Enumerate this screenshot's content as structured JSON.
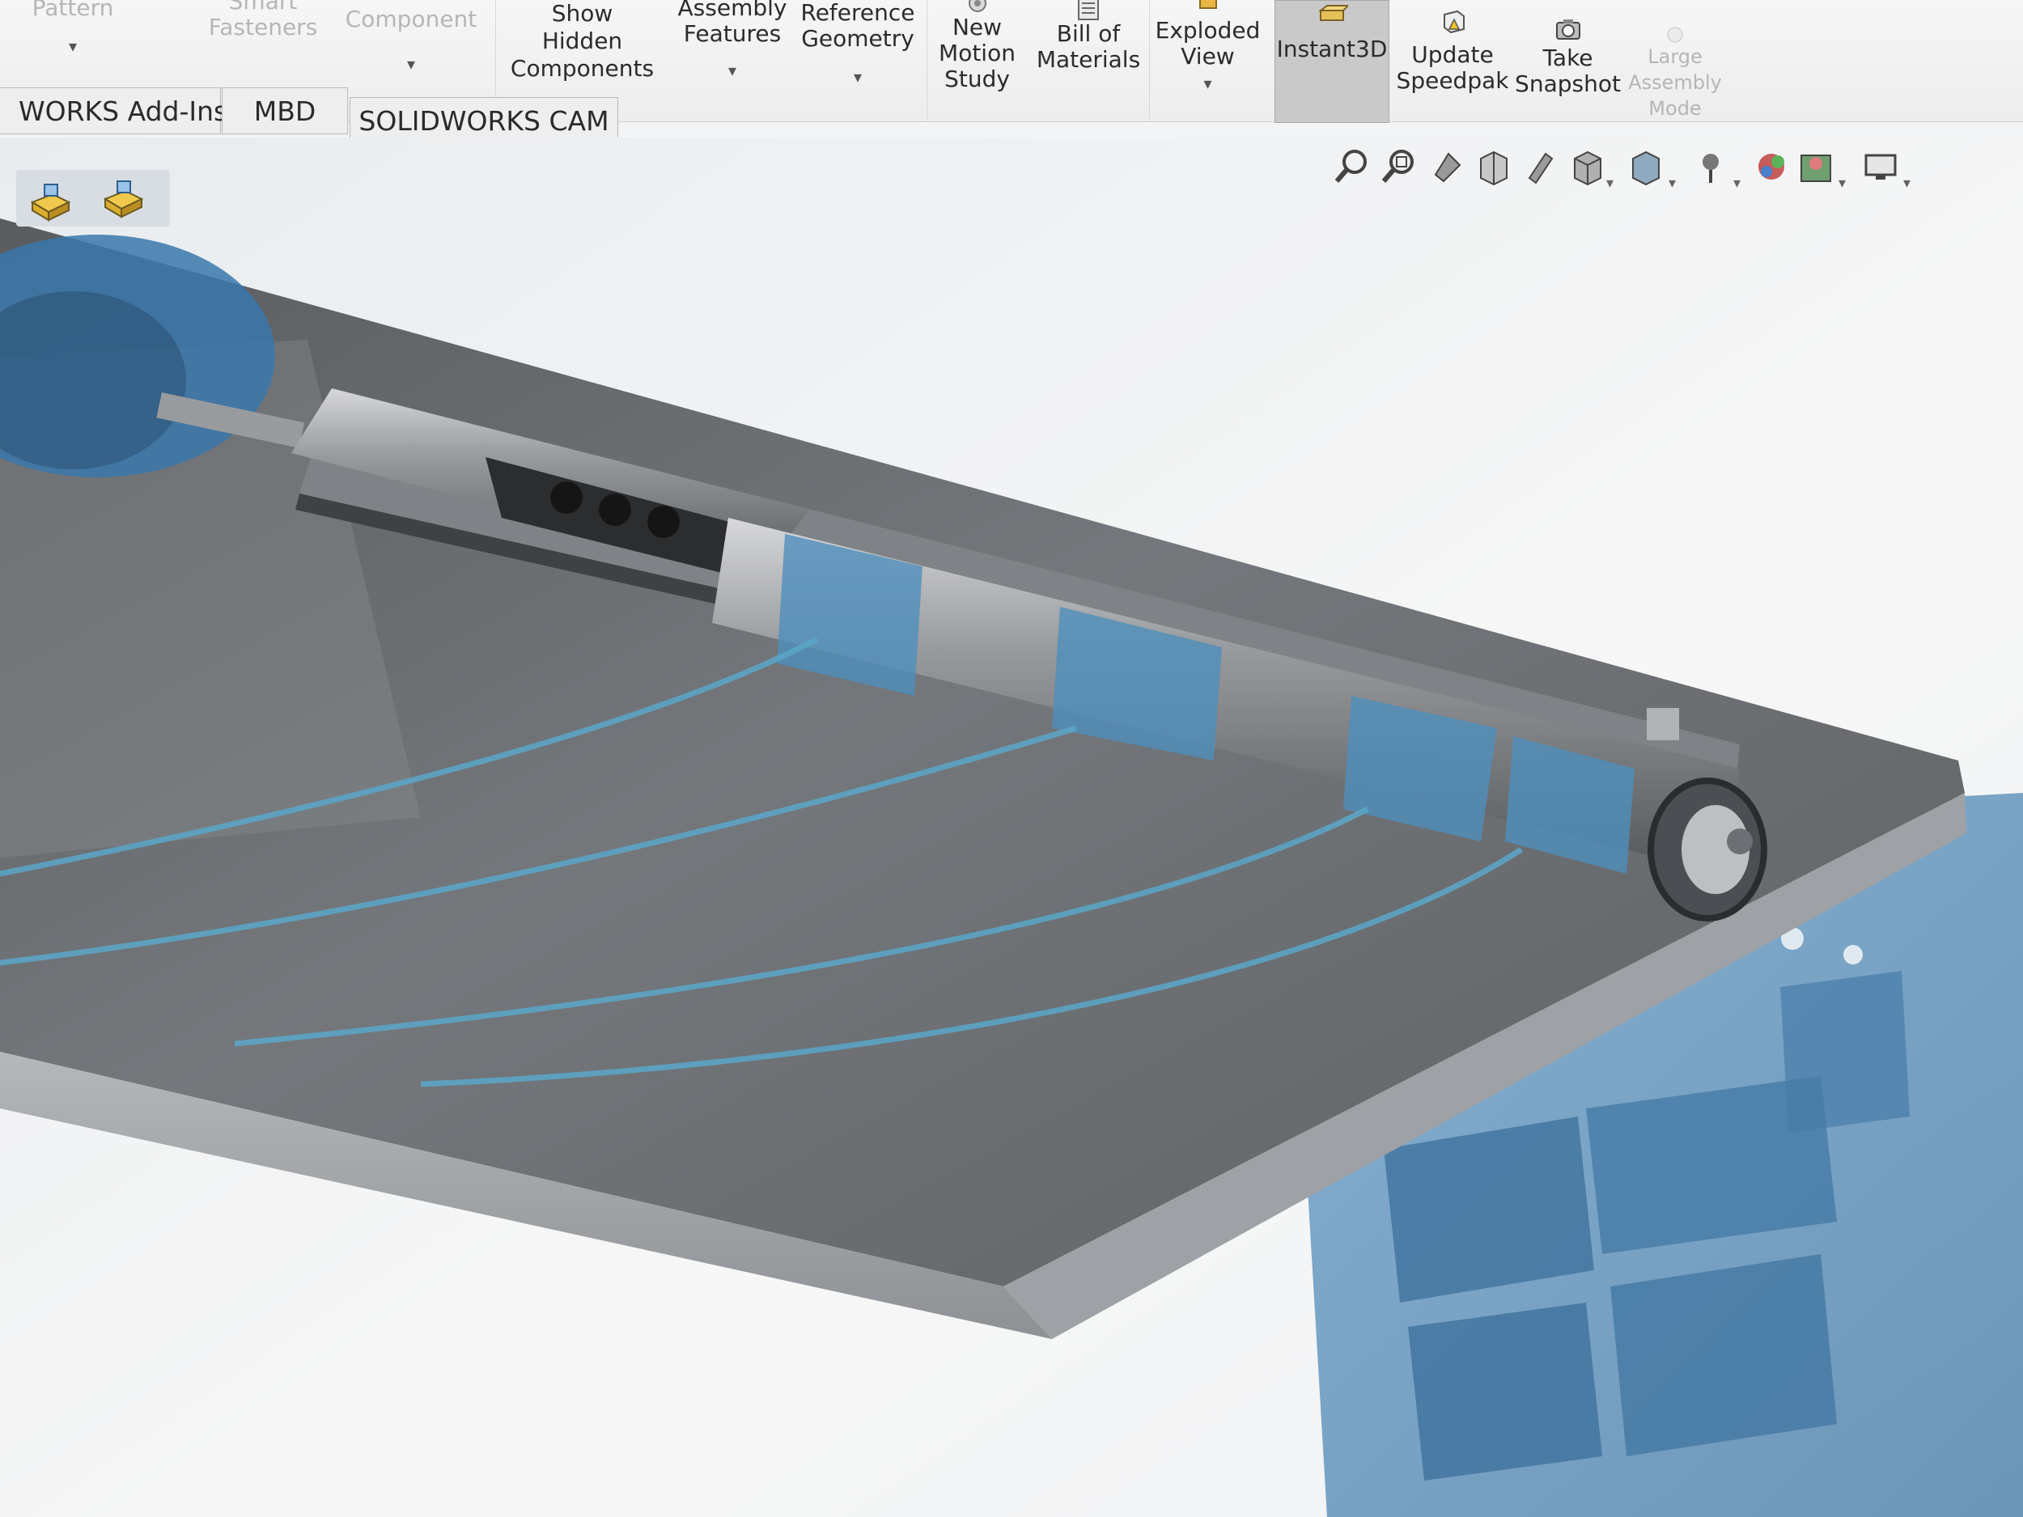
{
  "ribbon": {
    "buttons": [
      {
        "label": "Pattern",
        "state": "disabled"
      },
      {
        "label": "Smart\nFasteners",
        "state": "disabled"
      },
      {
        "label": "Component",
        "state": "disabled"
      },
      {
        "label": "Show\nHidden\nComponents",
        "state": "normal"
      },
      {
        "label": "Assembly\nFeatures",
        "state": "normal"
      },
      {
        "label": "Reference\nGeometry",
        "state": "normal"
      },
      {
        "label": "New\nMotion\nStudy",
        "state": "normal"
      },
      {
        "label": "Bill of\nMaterials",
        "state": "normal"
      },
      {
        "label": "Exploded\nView",
        "state": "normal"
      },
      {
        "label": "Instant3D",
        "state": "active"
      },
      {
        "label": "Update\nSpeedpak",
        "state": "normal"
      },
      {
        "label": "Take\nSnapshot",
        "state": "normal"
      },
      {
        "label": "Large\nAssembly\nMode",
        "state": "disabled"
      }
    ]
  },
  "tabs": [
    {
      "label": "WORKS Add-Ins"
    },
    {
      "label": "MBD"
    },
    {
      "label": "SOLIDWORKS CAM"
    }
  ],
  "view_toolbar": {
    "icons": [
      "zoom-to-fit-icon",
      "zoom-to-area-icon",
      "previous-view-icon",
      "section-view-icon",
      "dynamic-annotation-icon",
      "view-orientation-icon",
      "display-style-icon",
      "hide-show-items-icon",
      "edit-appearance-icon",
      "apply-scene-icon",
      "view-settings-icon"
    ]
  },
  "colors": {
    "ribbon_bg": "#f0f0f0",
    "active_button": "#c9c9c9",
    "plate_top": "#6b6b6b",
    "transparent_blue": "#3f7fb3",
    "cable": "#5aa7c9"
  }
}
